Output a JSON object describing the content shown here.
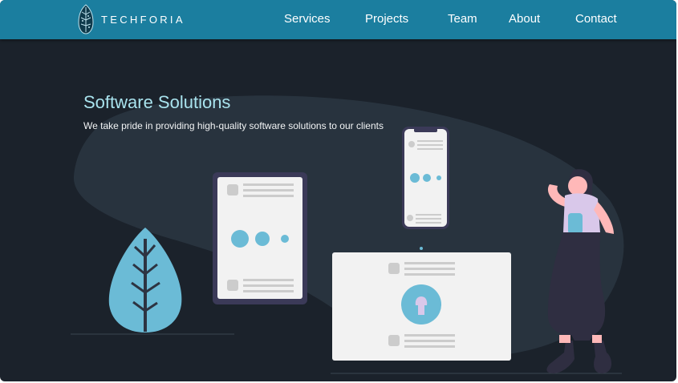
{
  "nav": {
    "brand": "TECHFORIA",
    "items": [
      "Services",
      "Projects",
      "Team",
      "About",
      "Contact"
    ]
  },
  "hero": {
    "title": "Software Solutions",
    "subtitle": "We take pride in providing high-quality software solutions to our clients"
  },
  "colors": {
    "nav_background": "#1b7e9f",
    "page_background": "#1b222b",
    "title_color": "#a9e3ee",
    "accent": "#6bbbd6"
  }
}
